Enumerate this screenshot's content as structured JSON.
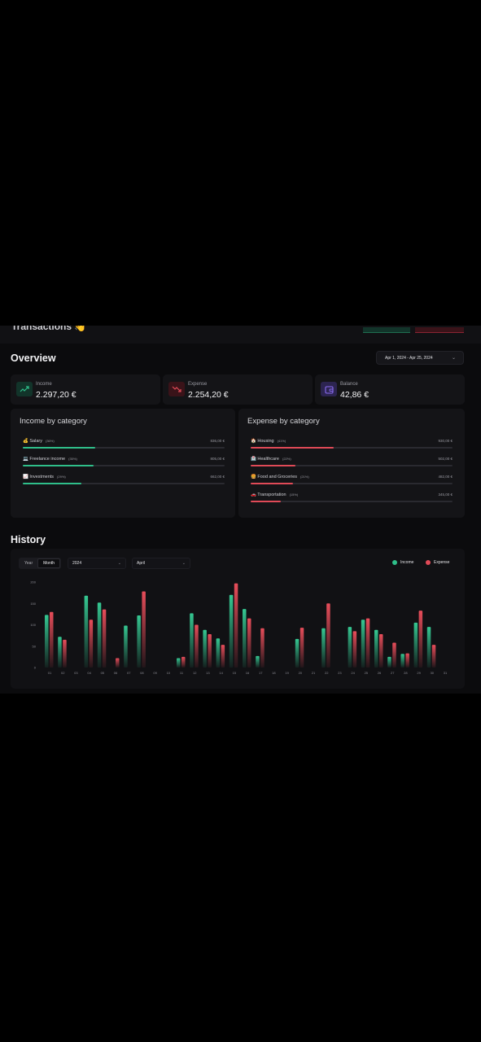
{
  "header": {
    "cut_title": "Transactions 👋"
  },
  "overview": {
    "title": "Overview",
    "date_range": "Apr 1, 2024 - Apr 25, 2024",
    "stats": [
      {
        "label": "Income",
        "value": "2.297,20 €",
        "icon": "trending-up-icon",
        "color": "#2fbf8a"
      },
      {
        "label": "Expense",
        "value": "2.254,20 €",
        "icon": "trending-down-icon",
        "color": "#e04a57"
      },
      {
        "label": "Balance",
        "value": "42,86 €",
        "icon": "wallet-icon",
        "color": "#8b6cf2"
      }
    ]
  },
  "income_by_category": {
    "title": "Income by category",
    "items": [
      {
        "icon": "💰",
        "name": "Salary",
        "pct": "(36%)",
        "amount": "836,00 €",
        "fraction": 0.36
      },
      {
        "icon": "💻",
        "name": "Freelance income",
        "pct": "(35%)",
        "amount": "805,00 €",
        "fraction": 0.35
      },
      {
        "icon": "📈",
        "name": "Investments",
        "pct": "(29%)",
        "amount": "662,00 €",
        "fraction": 0.29
      }
    ]
  },
  "expense_by_category": {
    "title": "Expense by category",
    "items": [
      {
        "icon": "🏠",
        "name": "Housing",
        "pct": "(41%)",
        "amount": "930,00 €",
        "fraction": 0.41
      },
      {
        "icon": "🏥",
        "name": "Healthcare",
        "pct": "(22%)",
        "amount": "502,00 €",
        "fraction": 0.22
      },
      {
        "icon": "🍔",
        "name": "Food and Groceries",
        "pct": "(21%)",
        "amount": "482,00 €",
        "fraction": 0.21
      },
      {
        "icon": "🚗",
        "name": "Transportation",
        "pct": "(15%)",
        "amount": "345,00 €",
        "fraction": 0.15
      }
    ]
  },
  "history": {
    "title": "History",
    "tabs": [
      {
        "label": "Year",
        "active": false
      },
      {
        "label": "Month",
        "active": true
      }
    ],
    "year_select": "2024",
    "month_select": "April",
    "legend": [
      {
        "name": "Income",
        "color": "#2fbf8a"
      },
      {
        "name": "Expense",
        "color": "#e04a57"
      }
    ]
  },
  "chart_data": {
    "type": "bar",
    "categories": [
      "01",
      "02",
      "03",
      "04",
      "05",
      "06",
      "07",
      "08",
      "09",
      "10",
      "11",
      "12",
      "13",
      "14",
      "15",
      "16",
      "17",
      "18",
      "19",
      "20",
      "21",
      "22",
      "23",
      "24",
      "25",
      "26",
      "27",
      "28",
      "29",
      "30",
      "31"
    ],
    "series": [
      {
        "name": "Income",
        "values": [
          123,
          72,
          0,
          168,
          152,
          0,
          98,
          122,
          0,
          0,
          22,
          127,
          88,
          68,
          170,
          137,
          27,
          0,
          0,
          67,
          0,
          92,
          0,
          95,
          112,
          88,
          25,
          32,
          105,
          95,
          0
        ]
      },
      {
        "name": "Expense",
        "values": [
          130,
          65,
          0,
          112,
          136,
          22,
          0,
          178,
          0,
          0,
          25,
          100,
          78,
          53,
          197,
          115,
          92,
          0,
          0,
          93,
          0,
          150,
          0,
          85,
          115,
          78,
          58,
          33,
          133,
          53,
          0
        ]
      }
    ],
    "ylim": [
      0,
      200
    ],
    "yticks": [
      0,
      50,
      100,
      150,
      200
    ],
    "ytick_labels": [
      "0",
      "50",
      "100",
      "150",
      "200"
    ],
    "grid": false,
    "legend_position": "top-right"
  }
}
